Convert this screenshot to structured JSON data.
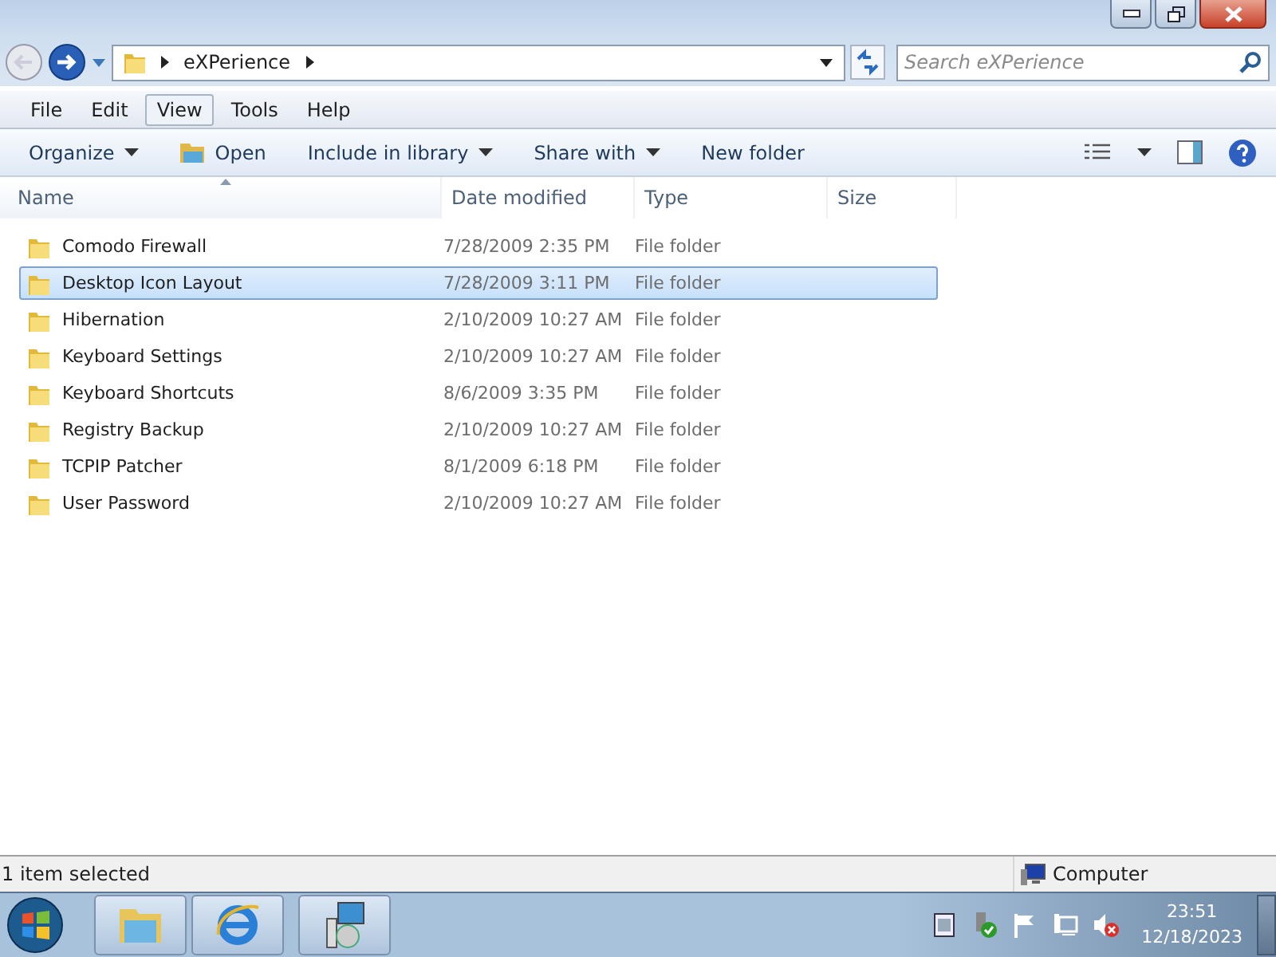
{
  "address": {
    "path": [
      "eXPerience"
    ]
  },
  "search": {
    "placeholder": "Search eXPerience"
  },
  "menu": [
    {
      "label": "File",
      "hovered": false
    },
    {
      "label": "Edit",
      "hovered": false
    },
    {
      "label": "View",
      "hovered": true
    },
    {
      "label": "Tools",
      "hovered": false
    },
    {
      "label": "Help",
      "hovered": false
    }
  ],
  "commands": [
    {
      "label": "Organize",
      "kind": "dropdown"
    },
    {
      "label": "Open",
      "kind": "open"
    },
    {
      "label": "Include in library",
      "kind": "dropdown"
    },
    {
      "label": "Share with",
      "kind": "dropdown"
    },
    {
      "label": "New folder",
      "kind": "plain"
    }
  ],
  "table": {
    "columns": [
      {
        "label": "Name",
        "sorted": true
      },
      {
        "label": "Date modified",
        "sorted": false
      },
      {
        "label": "Type",
        "sorted": false
      },
      {
        "label": "Size",
        "sorted": false
      }
    ],
    "rows": [
      {
        "name": "Comodo Firewall",
        "date": "7/28/2009 2:35 PM",
        "type": "File folder",
        "selected": false
      },
      {
        "name": "Desktop Icon Layout",
        "date": "7/28/2009 3:11 PM",
        "type": "File folder",
        "selected": true
      },
      {
        "name": "Hibernation",
        "date": "2/10/2009 10:27 AM",
        "type": "File folder",
        "selected": false
      },
      {
        "name": "Keyboard Settings",
        "date": "2/10/2009 10:27 AM",
        "type": "File folder",
        "selected": false
      },
      {
        "name": "Keyboard Shortcuts",
        "date": "8/6/2009 3:35 PM",
        "type": "File folder",
        "selected": false
      },
      {
        "name": "Registry Backup",
        "date": "2/10/2009 10:27 AM",
        "type": "File folder",
        "selected": false
      },
      {
        "name": "TCPIP Patcher",
        "date": "8/1/2009 6:18 PM",
        "type": "File folder",
        "selected": false
      },
      {
        "name": "User Password",
        "date": "2/10/2009 10:27 AM",
        "type": "File folder",
        "selected": false
      }
    ]
  },
  "status_bar": {
    "text": "1 item selected",
    "location": "Computer"
  },
  "taskbar": {
    "time": "23:51",
    "date": "12/18/2023"
  }
}
